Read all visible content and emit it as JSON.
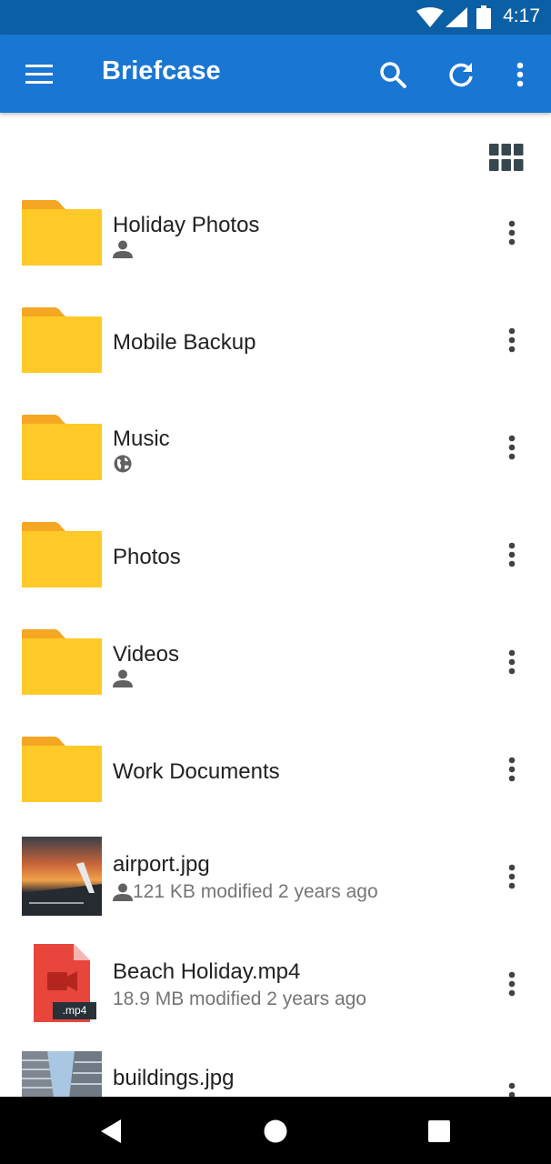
{
  "status_bar": {
    "time": "4:17",
    "icons": [
      "wifi-icon",
      "signal-icon",
      "battery-icon"
    ]
  },
  "app_bar": {
    "title": "Briefcase",
    "icons": [
      "menu-icon",
      "search-icon",
      "refresh-icon",
      "more-vert-icon"
    ],
    "color": "#1976d2"
  },
  "view_toggle": {
    "icon": "grid-view-icon"
  },
  "items": [
    {
      "name": "Holiday Photos",
      "kind": "folder",
      "badge": "person-icon",
      "meta": ""
    },
    {
      "name": "Mobile Backup",
      "kind": "folder",
      "badge": "",
      "meta": ""
    },
    {
      "name": "Music",
      "kind": "folder",
      "badge": "globe-icon",
      "meta": ""
    },
    {
      "name": "Photos",
      "kind": "folder",
      "badge": "",
      "meta": ""
    },
    {
      "name": "Videos",
      "kind": "folder",
      "badge": "person-icon",
      "meta": ""
    },
    {
      "name": "Work Documents",
      "kind": "folder",
      "badge": "",
      "meta": ""
    },
    {
      "name": "airport.jpg",
      "kind": "image",
      "badge": "person-icon",
      "meta": "121 KB modified 2 years ago"
    },
    {
      "name": "Beach Holiday.mp4",
      "kind": "video",
      "badge": "",
      "meta": "18.9 MB modified 2 years ago",
      "file_tag": ".mp4"
    },
    {
      "name": "buildings.jpg",
      "kind": "image",
      "badge": "",
      "meta": ""
    }
  ],
  "nav_bar": {
    "icons": [
      "back-icon",
      "home-icon",
      "recents-icon"
    ]
  },
  "colors": {
    "folder": "#ffca28",
    "folder_tab": "#f5a623",
    "video_file": "#e8453c"
  }
}
